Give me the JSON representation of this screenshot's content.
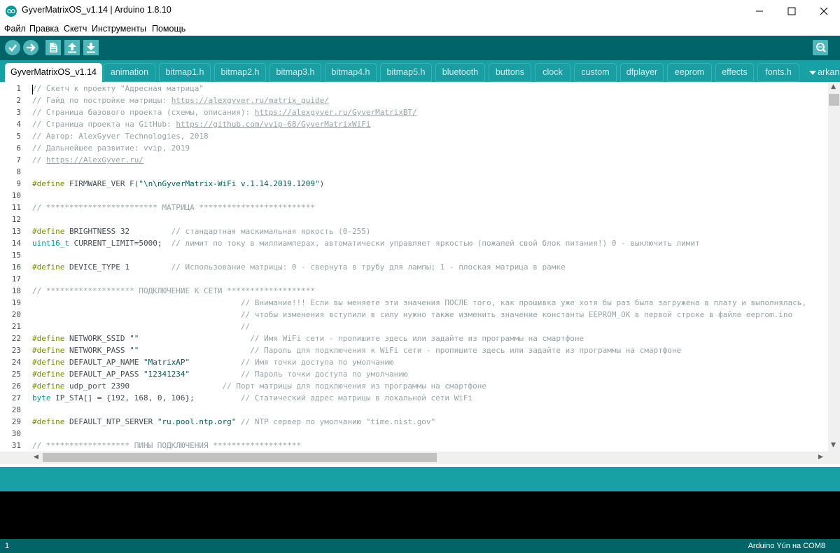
{
  "window": {
    "title": "GyverMatrixOS_v1.14 | Arduino 1.8.10",
    "controls": [
      "minimize-icon",
      "maximize-icon",
      "close-icon"
    ]
  },
  "menu": [
    "Файл",
    "Правка",
    "Скетч",
    "Инструменты",
    "Помощь"
  ],
  "toolbar": {
    "buttons": [
      "verify-icon",
      "upload-icon",
      "new-icon",
      "open-icon",
      "save-icon"
    ],
    "right_button": "serial-monitor-icon"
  },
  "tabs": {
    "items": [
      "GyverMatrixOS_v1.14",
      "animation",
      "bitmap1.h",
      "bitmap2.h",
      "bitmap3.h",
      "bitmap4.h",
      "bitmap5.h",
      "bluetooth",
      "buttons",
      "clock",
      "custom",
      "dfplayer",
      "eeprom",
      "effects",
      "fonts.h"
    ],
    "active": 0,
    "overflow_label": "arkan"
  },
  "editor": {
    "line_numbers": [
      "1",
      "2",
      "3",
      "4",
      "5",
      "6",
      "7",
      "8",
      "9",
      "10",
      "11",
      "12",
      "13",
      "14",
      "15",
      "16",
      "17",
      "18",
      "19",
      "20",
      "21",
      "22",
      "23",
      "24",
      "25",
      "26",
      "27",
      "28",
      "29",
      "30",
      "31"
    ],
    "lines": [
      [
        {
          "t": "// Скетч к проекту \"Адресная матрица\"",
          "c": "com"
        }
      ],
      [
        {
          "t": "// Гайд по постройке матрицы: ",
          "c": "com"
        },
        {
          "t": "https://alexgyver.ru/matrix_guide/",
          "c": "link"
        }
      ],
      [
        {
          "t": "// Страница базового проекта (схемы, описания): ",
          "c": "com"
        },
        {
          "t": "https://alexgyver.ru/GyverMatrixBT/",
          "c": "link"
        }
      ],
      [
        {
          "t": "// Страница проекта на GitHub: ",
          "c": "com"
        },
        {
          "t": "https://github.com/vvip-68/GyverMatrixWiFi",
          "c": "link"
        }
      ],
      [
        {
          "t": "// Автор: AlexGyver Technologies, 2018",
          "c": "com"
        }
      ],
      [
        {
          "t": "// Дальнейшее развитие: vvip, 2019",
          "c": "com"
        }
      ],
      [
        {
          "t": "// ",
          "c": "com"
        },
        {
          "t": "https://AlexGyver.ru/",
          "c": "link"
        }
      ],
      [],
      [
        {
          "t": "#define",
          "c": "kw"
        },
        {
          "t": " FIRMWARE_VER F(",
          "c": ""
        },
        {
          "t": "\"\\n\\nGyverMatrix-WiFi v.1.14.2019.1209\"",
          "c": "str"
        },
        {
          "t": ")",
          "c": ""
        }
      ],
      [],
      [
        {
          "t": "// ************************ МАТРИЦА *************************",
          "c": "com"
        }
      ],
      [],
      [
        {
          "t": "#define",
          "c": "kw"
        },
        {
          "t": " BRIGHTNESS 32         ",
          "c": ""
        },
        {
          "t": "// стандартная маскимальная яркость (0-255)",
          "c": "com"
        }
      ],
      [
        {
          "t": "uint16_t",
          "c": "ty"
        },
        {
          "t": " CURRENT_LIMIT=5000;  ",
          "c": ""
        },
        {
          "t": "// лимит по току в миллиамперах, автоматически управляет яркостью (пожалей свой блок питания!) 0 - выключить лимит",
          "c": "com"
        }
      ],
      [],
      [
        {
          "t": "#define",
          "c": "kw"
        },
        {
          "t": " DEVICE_TYPE 1         ",
          "c": ""
        },
        {
          "t": "// Использование матрицы: 0 - свернута в трубу для лампы; 1 - плоская матрица в рамке",
          "c": "com"
        }
      ],
      [],
      [
        {
          "t": "// ******************* ПОДКЛЮЧЕНИЕ К СЕТИ *******************",
          "c": "com"
        }
      ],
      [
        {
          "t": "                                             ",
          "c": ""
        },
        {
          "t": "// Внимание!!! Если вы меняете эти значения ПОСЛЕ того, как прошивка уже хотя бы раз была загружена в плату и выполнялась,",
          "c": "com"
        }
      ],
      [
        {
          "t": "                                             ",
          "c": ""
        },
        {
          "t": "// чтобы изменения вступили в силу нужно также изменить значение константы EEPROM_OK в первой строке в файле eeprom.ino",
          "c": "com"
        }
      ],
      [
        {
          "t": "                                             ",
          "c": ""
        },
        {
          "t": "//",
          "c": "com"
        }
      ],
      [
        {
          "t": "#define",
          "c": "kw"
        },
        {
          "t": " NETWORK_SSID ",
          "c": ""
        },
        {
          "t": "\"\"",
          "c": "str"
        },
        {
          "t": "                        ",
          "c": ""
        },
        {
          "t": "// Имя WiFi сети - пропишите здесь или задайте из программы на смартфоне",
          "c": "com"
        }
      ],
      [
        {
          "t": "#define",
          "c": "kw"
        },
        {
          "t": " NETWORK_PASS ",
          "c": ""
        },
        {
          "t": "\"\"",
          "c": "str"
        },
        {
          "t": "                        ",
          "c": ""
        },
        {
          "t": "// Пароль для подключения к WiFi сети - пропишите здесь или задайте из программы на смартфоне",
          "c": "com"
        }
      ],
      [
        {
          "t": "#define",
          "c": "kw"
        },
        {
          "t": " DEFAULT_AP_NAME ",
          "c": ""
        },
        {
          "t": "\"MatrixAP\"",
          "c": "str"
        },
        {
          "t": "           ",
          "c": ""
        },
        {
          "t": "// Имя точки доступа по умолчанию",
          "c": "com"
        }
      ],
      [
        {
          "t": "#define",
          "c": "kw"
        },
        {
          "t": " DEFAULT_AP_PASS ",
          "c": ""
        },
        {
          "t": "\"12341234\"",
          "c": "str"
        },
        {
          "t": "           ",
          "c": ""
        },
        {
          "t": "// Пароль точки доступа по умолчанию",
          "c": "com"
        }
      ],
      [
        {
          "t": "#define",
          "c": "kw"
        },
        {
          "t": " udp_port 2390                    ",
          "c": ""
        },
        {
          "t": "// Порт матрицы для подключения из программы на смартфоне",
          "c": "com"
        }
      ],
      [
        {
          "t": "byte",
          "c": "ty"
        },
        {
          "t": " IP_STA[] = {192, 168, 0, 106};          ",
          "c": ""
        },
        {
          "t": "// Статический адрес матрицы в локальной сети WiFi",
          "c": "com"
        }
      ],
      [],
      [
        {
          "t": "#define",
          "c": "kw"
        },
        {
          "t": " DEFAULT_NTP_SERVER ",
          "c": ""
        },
        {
          "t": "\"ru.pool.ntp.org\"",
          "c": "str"
        },
        {
          "t": " ",
          "c": ""
        },
        {
          "t": "// NTP сервер по умолчанию \"time.nist.gov\"",
          "c": "com"
        }
      ],
      [],
      [
        {
          "t": "// ****************** ПИНЫ ПОДКЛЮЧЕНИЯ *******************",
          "c": "com"
        }
      ]
    ]
  },
  "status": {
    "line": "1",
    "board": "Arduino Yún на COM8"
  },
  "colors": {
    "toolbar": "#006468",
    "tabstrip": "#17a1a5",
    "button": "#4db7bb",
    "keyword": "#728e00",
    "type": "#00979c",
    "string": "#005c5f",
    "comment": "#95a5a6"
  }
}
